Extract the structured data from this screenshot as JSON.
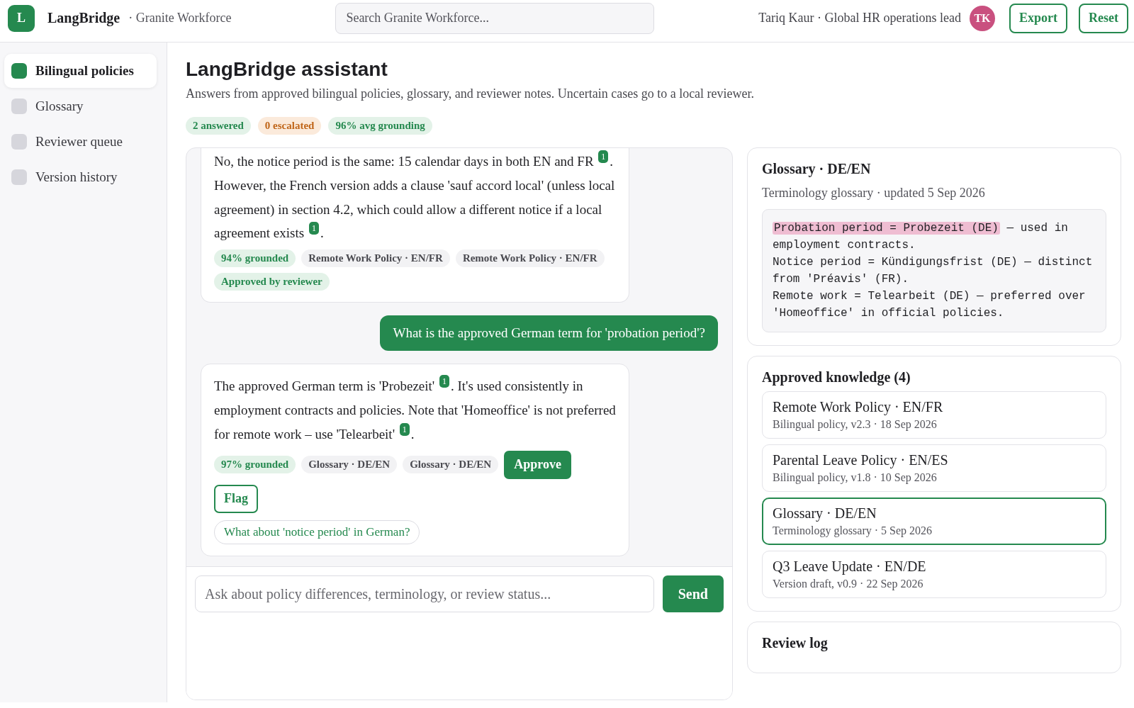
{
  "topbar": {
    "logo": "L",
    "brand": "LangBridge",
    "workspace": "· Granite Workforce",
    "search": {
      "placeholder": "Search Granite Workforce..."
    },
    "user": "Tariq Kaur · Global HR operations lead",
    "avatar": "TK",
    "buttons": [
      "Export",
      "Reset"
    ]
  },
  "sidebar": {
    "items": [
      {
        "label": "Bilingual policies",
        "selected": true
      },
      {
        "label": "Glossary",
        "selected": false
      },
      {
        "label": "Reviewer queue",
        "selected": false
      },
      {
        "label": "Version history",
        "selected": false
      }
    ]
  },
  "header": {
    "title": "LangBridge assistant",
    "subtitle": "Answers from approved bilingual policies, glossary, and reviewer notes. Uncertain cases go to a local reviewer.",
    "stats": [
      {
        "label": "2 answered",
        "kind": "good"
      },
      {
        "label": "0 escalated",
        "kind": "warn"
      },
      {
        "label": "96% avg grounding",
        "kind": "good"
      }
    ]
  },
  "chat": {
    "messages": [
      {
        "kind": "assistant",
        "text": "No, the notice period is the same: 15 calendar days in both EN and FR $^{1}$. However, the French version adds a clause 'sauf accord local' (unless local agreement) in section 4.2, which could allow a different notice if a local agreement exists $^{1}$.",
        "chips": [
          {
            "label": "94% grounded",
            "kind": "grounding"
          },
          {
            "label": "Remote Work Policy · EN/FR",
            "kind": "source"
          },
          {
            "label": "Remote Work Policy · EN/FR",
            "kind": "source"
          },
          {
            "label": "Approved by reviewer",
            "kind": "approval"
          }
        ]
      },
      {
        "kind": "user",
        "text": "What is the approved German term for 'probation period'?"
      },
      {
        "kind": "assistant",
        "text": "The approved German term is 'Probezeit' $^{1}$. It's used consistently in employment contracts and policies. Note that 'Homeoffice' is not preferred for remote work – use 'Telearbeit' $^{1}$.",
        "chips": [
          {
            "label": "97% grounded",
            "kind": "grounding"
          },
          {
            "label": "Glossary · DE/EN",
            "kind": "source"
          },
          {
            "label": "Glossary · DE/EN",
            "kind": "source"
          }
        ],
        "actions": [
          {
            "label": "Approve",
            "kind": "primary"
          },
          {
            "label": "Flag",
            "kind": "outline"
          }
        ],
        "suggestion": "What about 'notice period' in German?"
      }
    ],
    "input": {
      "placeholder": "Ask about policy differences, terminology, or review status..."
    },
    "send": "Send"
  },
  "glossary": {
    "title": "Glossary · DE/EN",
    "meta": "Terminology glossary · updated 5 Sep 2026",
    "lines": [
      {
        "term": "Probation period = Probezeit (DE)",
        "rest": " — used in employment contracts.",
        "highlighted": true
      },
      {
        "term": "Notice period = Kündigungsfrist (DE)",
        "rest": " — distinct from 'Préavis' (FR).",
        "highlighted": false
      },
      {
        "term": "Remote work = Telearbeit (DE)",
        "rest": " — preferred over 'Homeoffice' in official policies.",
        "highlighted": false
      }
    ]
  },
  "knowledge": {
    "title": "Approved knowledge (4)",
    "items": [
      {
        "title": "Remote Work Policy · EN/FR",
        "meta": "Bilingual policy, v2.3 · 18 Sep 2026",
        "selected": false
      },
      {
        "title": "Parental Leave Policy · EN/ES",
        "meta": "Bilingual policy, v1.8 · 10 Sep 2026",
        "selected": false
      },
      {
        "title": "Glossary · DE/EN",
        "meta": "Terminology glossary · 5 Sep 2026",
        "selected": true
      },
      {
        "title": "Q3 Leave Update · EN/DE",
        "meta": "Version draft, v0.9 · 22 Sep 2026",
        "selected": false
      }
    ]
  },
  "review_log": {
    "title": "Review log"
  }
}
